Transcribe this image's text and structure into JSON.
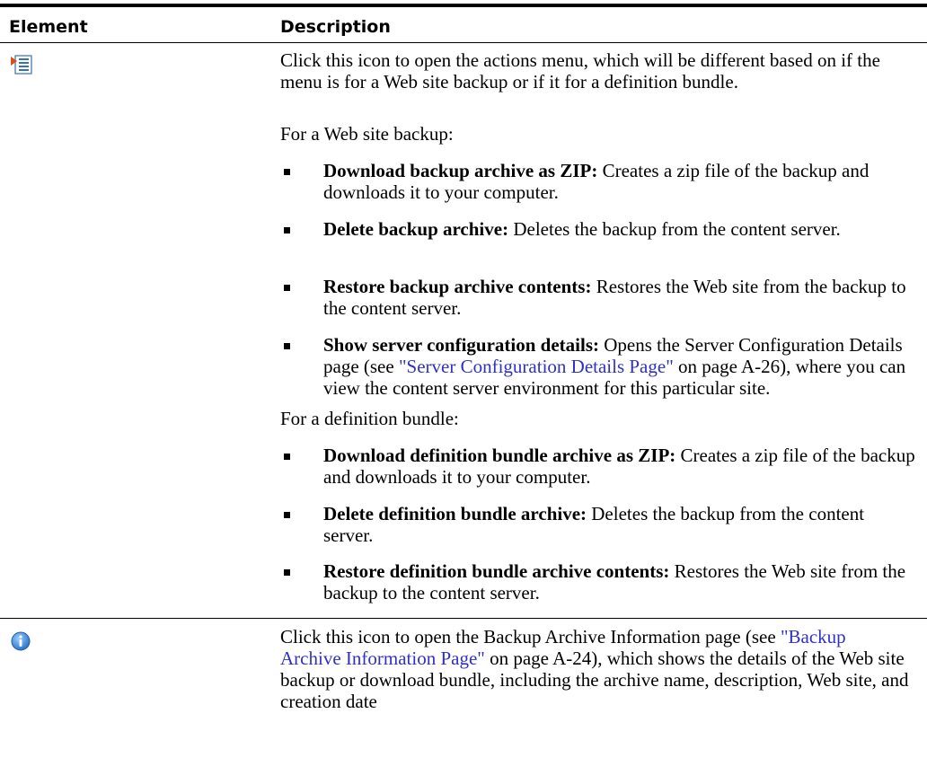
{
  "table": {
    "headers": {
      "element": "Element",
      "description": "Description"
    },
    "rows": [
      {
        "icon": "actions-menu-icon",
        "intro": "Click this icon to open the actions menu, which will be different based on if the menu is for a Web site backup or if it for a definition bundle.",
        "backup_heading": "For a Web site backup:",
        "backup_items": [
          {
            "term": "Download backup archive as ZIP:",
            "text": " Creates a zip file of the backup and downloads it to your computer."
          },
          {
            "term": "Delete backup archive:",
            "text": " Deletes the backup from the content server."
          },
          {
            "term": "Restore backup archive contents:",
            "text": " Restores the Web site from the backup to the content server."
          },
          {
            "term": "Show server configuration details:",
            "text_before": " Opens the Server Configuration Details page (see ",
            "link": "\"Server Configuration Details Page\"",
            "text_after": " on page A-26), where you can view the content server environment for this particular site."
          }
        ],
        "bundle_heading": "For a definition bundle:",
        "bundle_items": [
          {
            "term": "Download definition bundle archive as ZIP:",
            "text": " Creates a zip file of the backup and downloads it to your computer."
          },
          {
            "term": "Delete definition bundle archive:",
            "text": " Deletes the backup from the content server."
          },
          {
            "term": "Restore definition bundle archive contents:",
            "text": " Restores the Web site from the backup to the content server."
          }
        ]
      },
      {
        "icon": "info-icon",
        "text_before": "Click this icon to open the Backup Archive Information page (see ",
        "link": "\"Backup Archive Information Page\"",
        "text_after": " on page A-24), which shows the details of the Web site backup or download bundle, including the archive name, description, Web site, and creation date"
      }
    ]
  },
  "colors": {
    "link": "#3030c8",
    "rule": "#000000"
  }
}
